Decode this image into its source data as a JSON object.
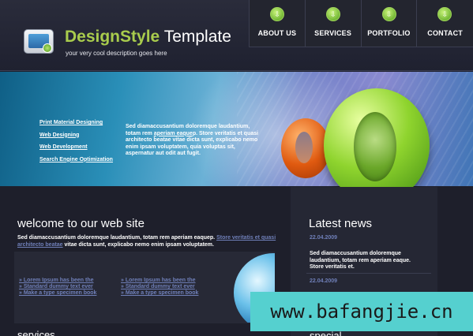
{
  "brand": {
    "title_part1": "DesignStyle",
    "title_part2": "Template",
    "tagline": "your very cool description goes here"
  },
  "nav": [
    {
      "label": "ABOUT US",
      "icon": "download-icon"
    },
    {
      "label": "SERVICES",
      "icon": "download-icon"
    },
    {
      "label": "PORTFOLIO",
      "icon": "download-icon"
    },
    {
      "label": "CONTACT",
      "icon": "download-icon"
    }
  ],
  "banner": {
    "links": [
      "Print Material Designing",
      "Web Designing",
      "Web Development",
      "Search Engine Optimization"
    ],
    "text_before": "Sed diamaccusantium doloremque laudantium, totam rem ",
    "text_link": "aperiam eaque",
    "text_after": "p. Store veritatis et quasi architecto beatae vitae dicta sunt, explicabo nemo enim ipsam voluptatem, quia voluptas sit, aspernatur aut odit aut fugit."
  },
  "welcome": {
    "title": "welcome to our web site",
    "text_before": "Sed diamaccusantium doloremque laudantium, totam rem aperiam eaquep. ",
    "text_link": "Store veritatis et quasi architecto beatae",
    "text_after": " vitae dicta sunt, explicabo nemo enim ipsam voluptatem."
  },
  "lists": {
    "col1": [
      "» Lorem Ipsum has been the",
      "» Standard dummy text ever",
      "» Make a type specimen book"
    ],
    "col2": [
      "» Lorem Ipsum has been the",
      "» Standard dummy text ever",
      "» Make a type specimen book"
    ]
  },
  "news": {
    "title": "Latest news",
    "items": [
      {
        "date": "22.04.2009",
        "text": "Sed diamaccusantium doloremque laudantium, totam rem aperiam eaque. Store veritatis et."
      },
      {
        "date": "22.04.2009",
        "text": ""
      }
    ]
  },
  "sections": {
    "services": "services",
    "special": "special"
  },
  "watermark": "www.bafangjie.cn"
}
